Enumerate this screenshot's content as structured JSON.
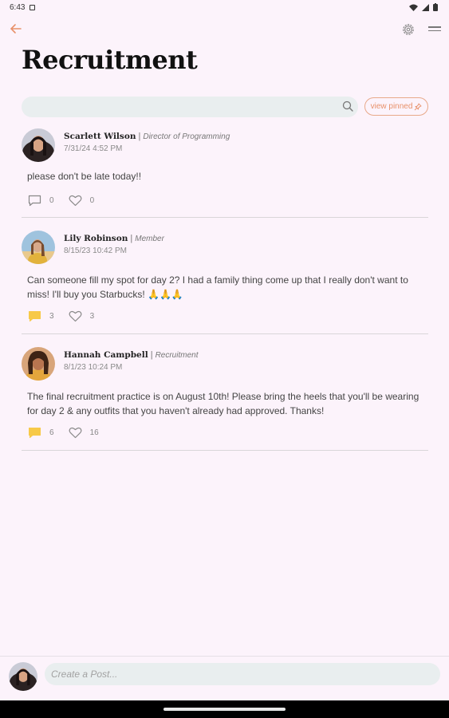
{
  "status_bar": {
    "time": "6:43"
  },
  "header": {
    "title": "Recruitment"
  },
  "search": {
    "placeholder": "",
    "pinned_label": "view pinned"
  },
  "posts": [
    {
      "author": "Scarlett Wilson",
      "role": "Director of Programming",
      "date": "7/31/24 4:52 PM",
      "text": "please don't be late today!!",
      "comments": "0",
      "likes": "0",
      "has_comments": false
    },
    {
      "author": "Lily Robinson",
      "role": "Member",
      "date": "8/15/23 10:42 PM",
      "text": "Can someone fill my spot for day 2? I had a family thing come up that I really don't want to miss! I'll buy you Starbucks! 🙏🙏🙏",
      "comments": "3",
      "likes": "3",
      "has_comments": true
    },
    {
      "author": "Hannah Campbell",
      "role": "Recruitment",
      "date": "8/1/23 10:24 PM",
      "text": "The final recruitment practice is on August 10th! Please bring the heels that you'll be wearing for day 2 & any outfits that you haven't already had approved. Thanks!",
      "comments": "6",
      "likes": "16",
      "has_comments": true
    }
  ],
  "composer": {
    "placeholder": "Create a Post..."
  },
  "colors": {
    "accent": "#e8916a",
    "background": "#fcf3fb",
    "comment_active": "#f7c948",
    "field": "#e9eeef"
  }
}
